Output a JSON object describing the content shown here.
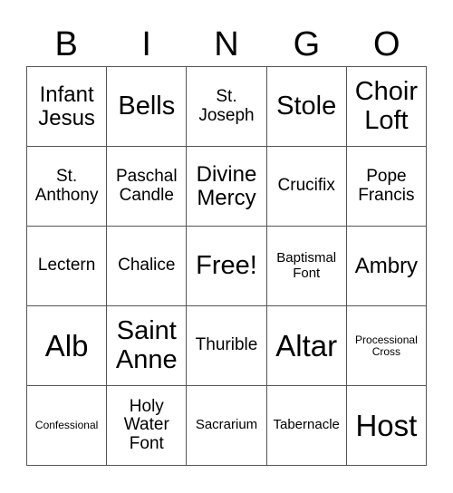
{
  "header": {
    "letters": [
      "B",
      "I",
      "N",
      "G",
      "O"
    ]
  },
  "cells": [
    [
      {
        "text": "Infant Jesus",
        "size": "s-lg"
      },
      {
        "text": "Bells",
        "size": "s-xl"
      },
      {
        "text": "St. Joseph",
        "size": "s-md"
      },
      {
        "text": "Stole",
        "size": "s-xl"
      },
      {
        "text": "Choir Loft",
        "size": "s-xl"
      }
    ],
    [
      {
        "text": "St. Anthony",
        "size": "s-md"
      },
      {
        "text": "Paschal Candle",
        "size": "s-md"
      },
      {
        "text": "Divine Mercy",
        "size": "s-lg"
      },
      {
        "text": "Crucifix",
        "size": "s-md"
      },
      {
        "text": "Pope Francis",
        "size": "s-md"
      }
    ],
    [
      {
        "text": "Lectern",
        "size": "s-md"
      },
      {
        "text": "Chalice",
        "size": "s-md"
      },
      {
        "text": "Free!",
        "size": "s-xl"
      },
      {
        "text": "Baptismal Font",
        "size": "s-sm"
      },
      {
        "text": "Ambry",
        "size": "s-lg"
      }
    ],
    [
      {
        "text": "Alb",
        "size": "s-xxl"
      },
      {
        "text": "Saint Anne",
        "size": "s-xl"
      },
      {
        "text": "Thurible",
        "size": "s-md"
      },
      {
        "text": "Altar",
        "size": "s-xxl"
      },
      {
        "text": "Processional Cross",
        "size": "s-xs"
      }
    ],
    [
      {
        "text": "Confessional",
        "size": "s-xs"
      },
      {
        "text": "Holy Water Font",
        "size": "s-md"
      },
      {
        "text": "Sacrarium",
        "size": "s-sm"
      },
      {
        "text": "Tabernacle",
        "size": "s-sm"
      },
      {
        "text": "Host",
        "size": "s-xxl"
      }
    ]
  ]
}
